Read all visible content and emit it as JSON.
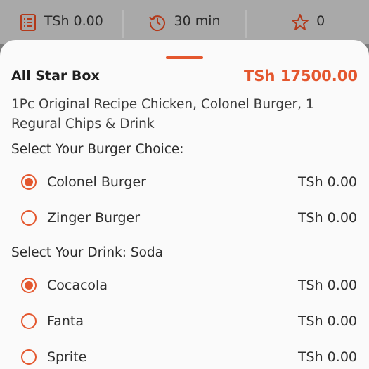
{
  "topbar": {
    "price": {
      "icon": "receipt-icon",
      "label": "TSh 0.00"
    },
    "time": {
      "icon": "history-clock-icon",
      "label": "30 min"
    },
    "rating": {
      "icon": "star-icon",
      "label": "0"
    }
  },
  "product": {
    "title": "All Star Box",
    "price": "TSh 17500.00",
    "description": "1Pc Original Recipe Chicken, Colonel Burger, 1 Regural Chips & Drink"
  },
  "burger_section": {
    "label": "Select Your Burger Choice:",
    "options": [
      {
        "name": "Colonel Burger",
        "price": "TSh 0.00",
        "selected": true
      },
      {
        "name": "Zinger Burger",
        "price": "TSh 0.00",
        "selected": false
      }
    ]
  },
  "drink_section": {
    "label": "Select Your Drink: Soda",
    "options": [
      {
        "name": "Cocacola",
        "price": "TSh 0.00",
        "selected": true
      },
      {
        "name": "Fanta",
        "price": "TSh 0.00",
        "selected": false
      },
      {
        "name": "Sprite",
        "price": "TSh 0.00",
        "selected": false
      }
    ]
  },
  "colors": {
    "accent": "#e4572e",
    "overlay": "#a9a9a9"
  }
}
